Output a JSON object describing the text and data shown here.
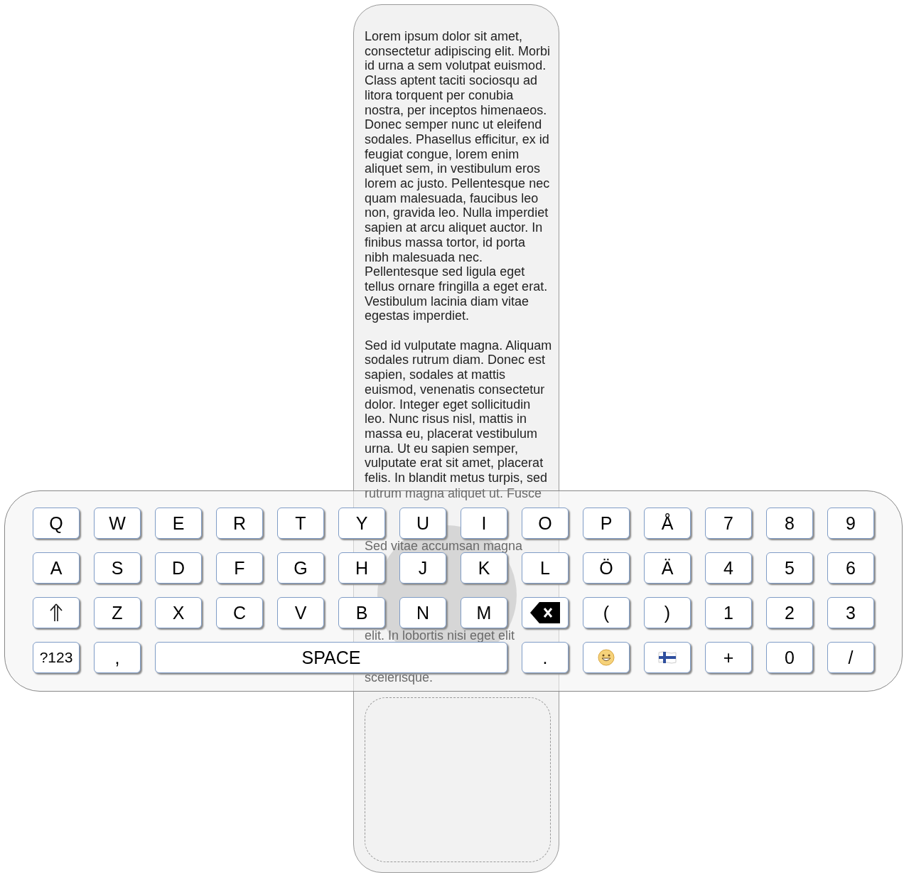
{
  "document": {
    "paragraphs": [
      {
        "lines": [
          "Lorem ipsum dolor sit amet,",
          "consectetur adipiscing elit. Morbi",
          "id urna a sem volutpat euismod.",
          "Class aptent taciti sociosqu ad",
          "litora torquent per conubia",
          "nostra, per inceptos himenaeos.",
          "Donec semper nunc ut eleifend",
          "sodales. Phasellus efficitur, ex id",
          "feugiat congue, lorem enim",
          "aliquet sem, in vestibulum eros",
          "lorem ac justo. Pellentesque nec",
          "quam malesuada, faucibus leo",
          "non, gravida leo. Nulla imperdiet",
          "sapien at arcu aliquet auctor. In",
          "finibus massa tortor, id porta",
          "nibh malesuada nec.",
          "Pellentesque sed ligula eget",
          "tellus ornare fringilla a eget erat.",
          "Vestibulum lacinia diam vitae",
          "egestas imperdiet."
        ]
      },
      {
        "lines": [
          "Sed id vulputate magna. Aliquam",
          "sodales rutrum diam. Donec est",
          "sapien, sodales at mattis",
          "euismod, venenatis consectetur",
          "dolor. Integer eget sollicitudin",
          "leo. Nunc risus nisl, mattis in",
          "massa eu, placerat vestibulum",
          "urna. Ut eu sapien semper,",
          "vulputate erat sit amet, placerat",
          "felis. In blandit metus turpis, sed"
        ]
      }
    ],
    "lines_behind_keyboard": [
      "rutrum magna aliquet ut. Fusce",
      "Sed vitae accumsan magna",
      "elit. In lobortis nisi eget elit",
      "scelerisque."
    ]
  },
  "keyboard": {
    "rows": [
      [
        {
          "kind": "char",
          "label": "Q"
        },
        {
          "kind": "char",
          "label": "W"
        },
        {
          "kind": "char",
          "label": "E"
        },
        {
          "kind": "char",
          "label": "R"
        },
        {
          "kind": "char",
          "label": "T"
        },
        {
          "kind": "char",
          "label": "Y"
        },
        {
          "kind": "char",
          "label": "U"
        },
        {
          "kind": "char",
          "label": "I"
        },
        {
          "kind": "char",
          "label": "O"
        },
        {
          "kind": "char",
          "label": "P"
        },
        {
          "kind": "char",
          "label": "Å"
        },
        {
          "kind": "char",
          "label": "7"
        },
        {
          "kind": "char",
          "label": "8"
        },
        {
          "kind": "char",
          "label": "9"
        }
      ],
      [
        {
          "kind": "char",
          "label": "A"
        },
        {
          "kind": "char",
          "label": "S"
        },
        {
          "kind": "char",
          "label": "D"
        },
        {
          "kind": "char",
          "label": "F"
        },
        {
          "kind": "char",
          "label": "G"
        },
        {
          "kind": "char",
          "label": "H"
        },
        {
          "kind": "char",
          "label": "J"
        },
        {
          "kind": "char",
          "label": "K"
        },
        {
          "kind": "char",
          "label": "L"
        },
        {
          "kind": "char",
          "label": "Ö"
        },
        {
          "kind": "char",
          "label": "Ä"
        },
        {
          "kind": "char",
          "label": "4"
        },
        {
          "kind": "char",
          "label": "5"
        },
        {
          "kind": "char",
          "label": "6"
        }
      ],
      [
        {
          "kind": "shift"
        },
        {
          "kind": "char",
          "label": "Z"
        },
        {
          "kind": "char",
          "label": "X"
        },
        {
          "kind": "char",
          "label": "C"
        },
        {
          "kind": "char",
          "label": "V"
        },
        {
          "kind": "char",
          "label": "B"
        },
        {
          "kind": "char",
          "label": "N"
        },
        {
          "kind": "char",
          "label": "M"
        },
        {
          "kind": "backspace"
        },
        {
          "kind": "char",
          "label": "("
        },
        {
          "kind": "char",
          "label": ")"
        },
        {
          "kind": "char",
          "label": "1"
        },
        {
          "kind": "char",
          "label": "2"
        },
        {
          "kind": "char",
          "label": "3"
        }
      ]
    ],
    "bottom_row": [
      {
        "kind": "mode",
        "label": "?123"
      },
      {
        "kind": "char",
        "label": ","
      },
      {
        "kind": "space",
        "label": "SPACE"
      },
      {
        "kind": "char",
        "label": "."
      },
      {
        "kind": "emoji"
      },
      {
        "kind": "language"
      },
      {
        "kind": "char",
        "label": "+"
      },
      {
        "kind": "char",
        "label": "0"
      },
      {
        "kind": "char",
        "label": "/"
      }
    ]
  }
}
